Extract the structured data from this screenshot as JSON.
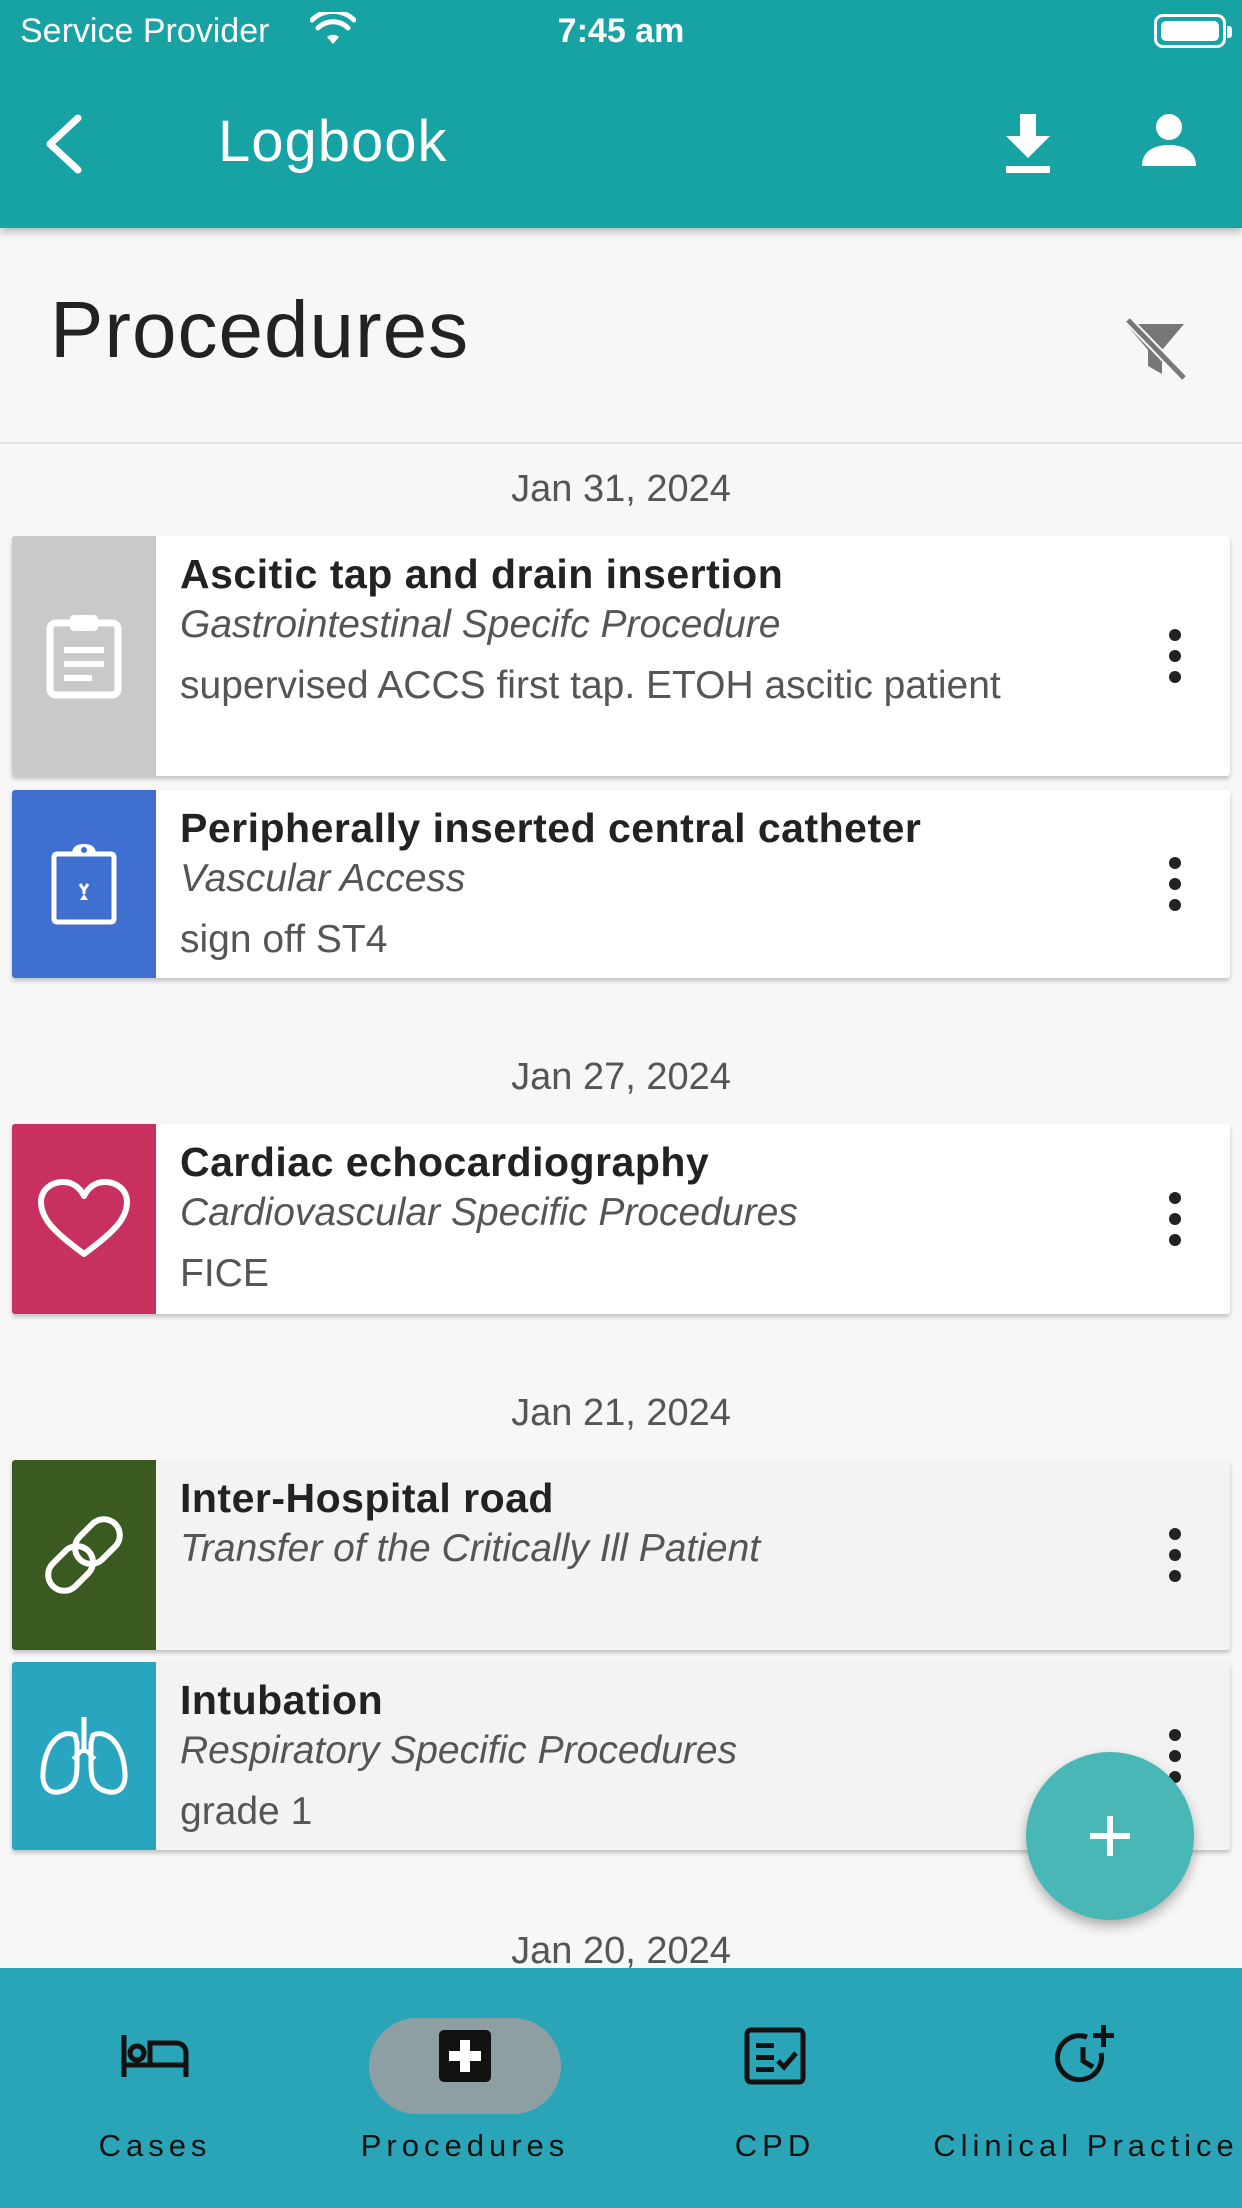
{
  "status_bar": {
    "carrier": "Service Provider",
    "time": "7:45 am"
  },
  "app_bar": {
    "title": "Logbook"
  },
  "page": {
    "title": "Procedures"
  },
  "groups": [
    {
      "date": "Jan 31, 2024",
      "items": [
        {
          "name": "Ascitic tap and drain insertion",
          "category": "Gastrointestinal Specifc Procedure",
          "note": "supervised ACCS first tap. ETOH ascitic patient",
          "icon": "clipboard-icon",
          "color": "#c9c9c9"
        },
        {
          "name": "Peripherally inserted central catheter",
          "category": "Vascular Access",
          "note": "sign off ST4",
          "icon": "clipboard-medical-icon",
          "color": "#3f6fcf"
        }
      ]
    },
    {
      "date": "Jan 27, 2024",
      "items": [
        {
          "name": "Cardiac echocardiography",
          "category": "Cardiovascular Specific Procedures",
          "note": "FICE",
          "icon": "heart-icon",
          "color": "#c8305f"
        }
      ]
    },
    {
      "date": "Jan 21, 2024",
      "items": [
        {
          "name": "Inter-Hospital road",
          "category": "Transfer of the Critically Ill Patient",
          "note": "",
          "icon": "link-icon",
          "color": "#3a5a22"
        },
        {
          "name": "Intubation",
          "category": "Respiratory Specific Procedures",
          "note": "grade 1",
          "icon": "lungs-icon",
          "color": "#2aa5c0"
        }
      ]
    },
    {
      "date": "Jan 20, 2024",
      "items": []
    }
  ],
  "bottom_nav": [
    {
      "label": "Cases",
      "icon": "bed-icon"
    },
    {
      "label": "Procedures",
      "icon": "medical-plus-icon",
      "active": true
    },
    {
      "label": "CPD",
      "icon": "checklist-icon"
    },
    {
      "label": "Clinical Practice",
      "icon": "clock-plus-icon"
    }
  ],
  "colors": {
    "primary": "#17a2a4",
    "nav": "#2aa5b7",
    "fab": "#48b7b6"
  }
}
